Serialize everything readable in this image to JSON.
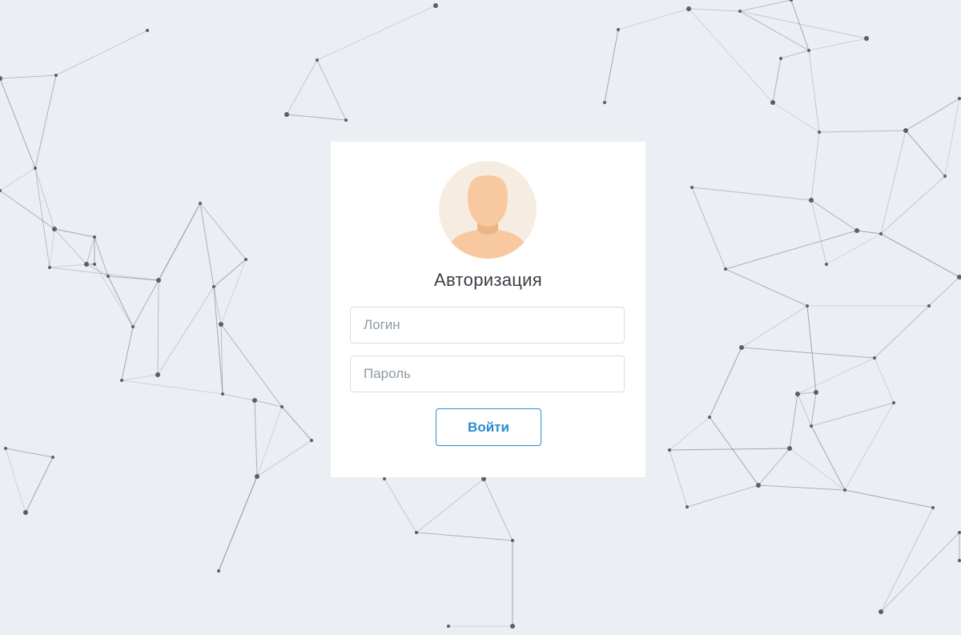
{
  "login_form": {
    "title": "Авторизация",
    "login_placeholder": "Логин",
    "password_placeholder": "Пароль",
    "submit_label": "Войти"
  },
  "colors": {
    "background": "#ebeef2",
    "card": "#ffffff",
    "accent": "#2a8ccf",
    "avatar_circle": "#f7ece2",
    "avatar_skin": "#f8c9a0",
    "avatar_shadow": "#eab487",
    "network_line": "#7c8088",
    "network_node": "#5a5e65"
  },
  "icons": {
    "avatar": "user-silhouette-icon"
  }
}
